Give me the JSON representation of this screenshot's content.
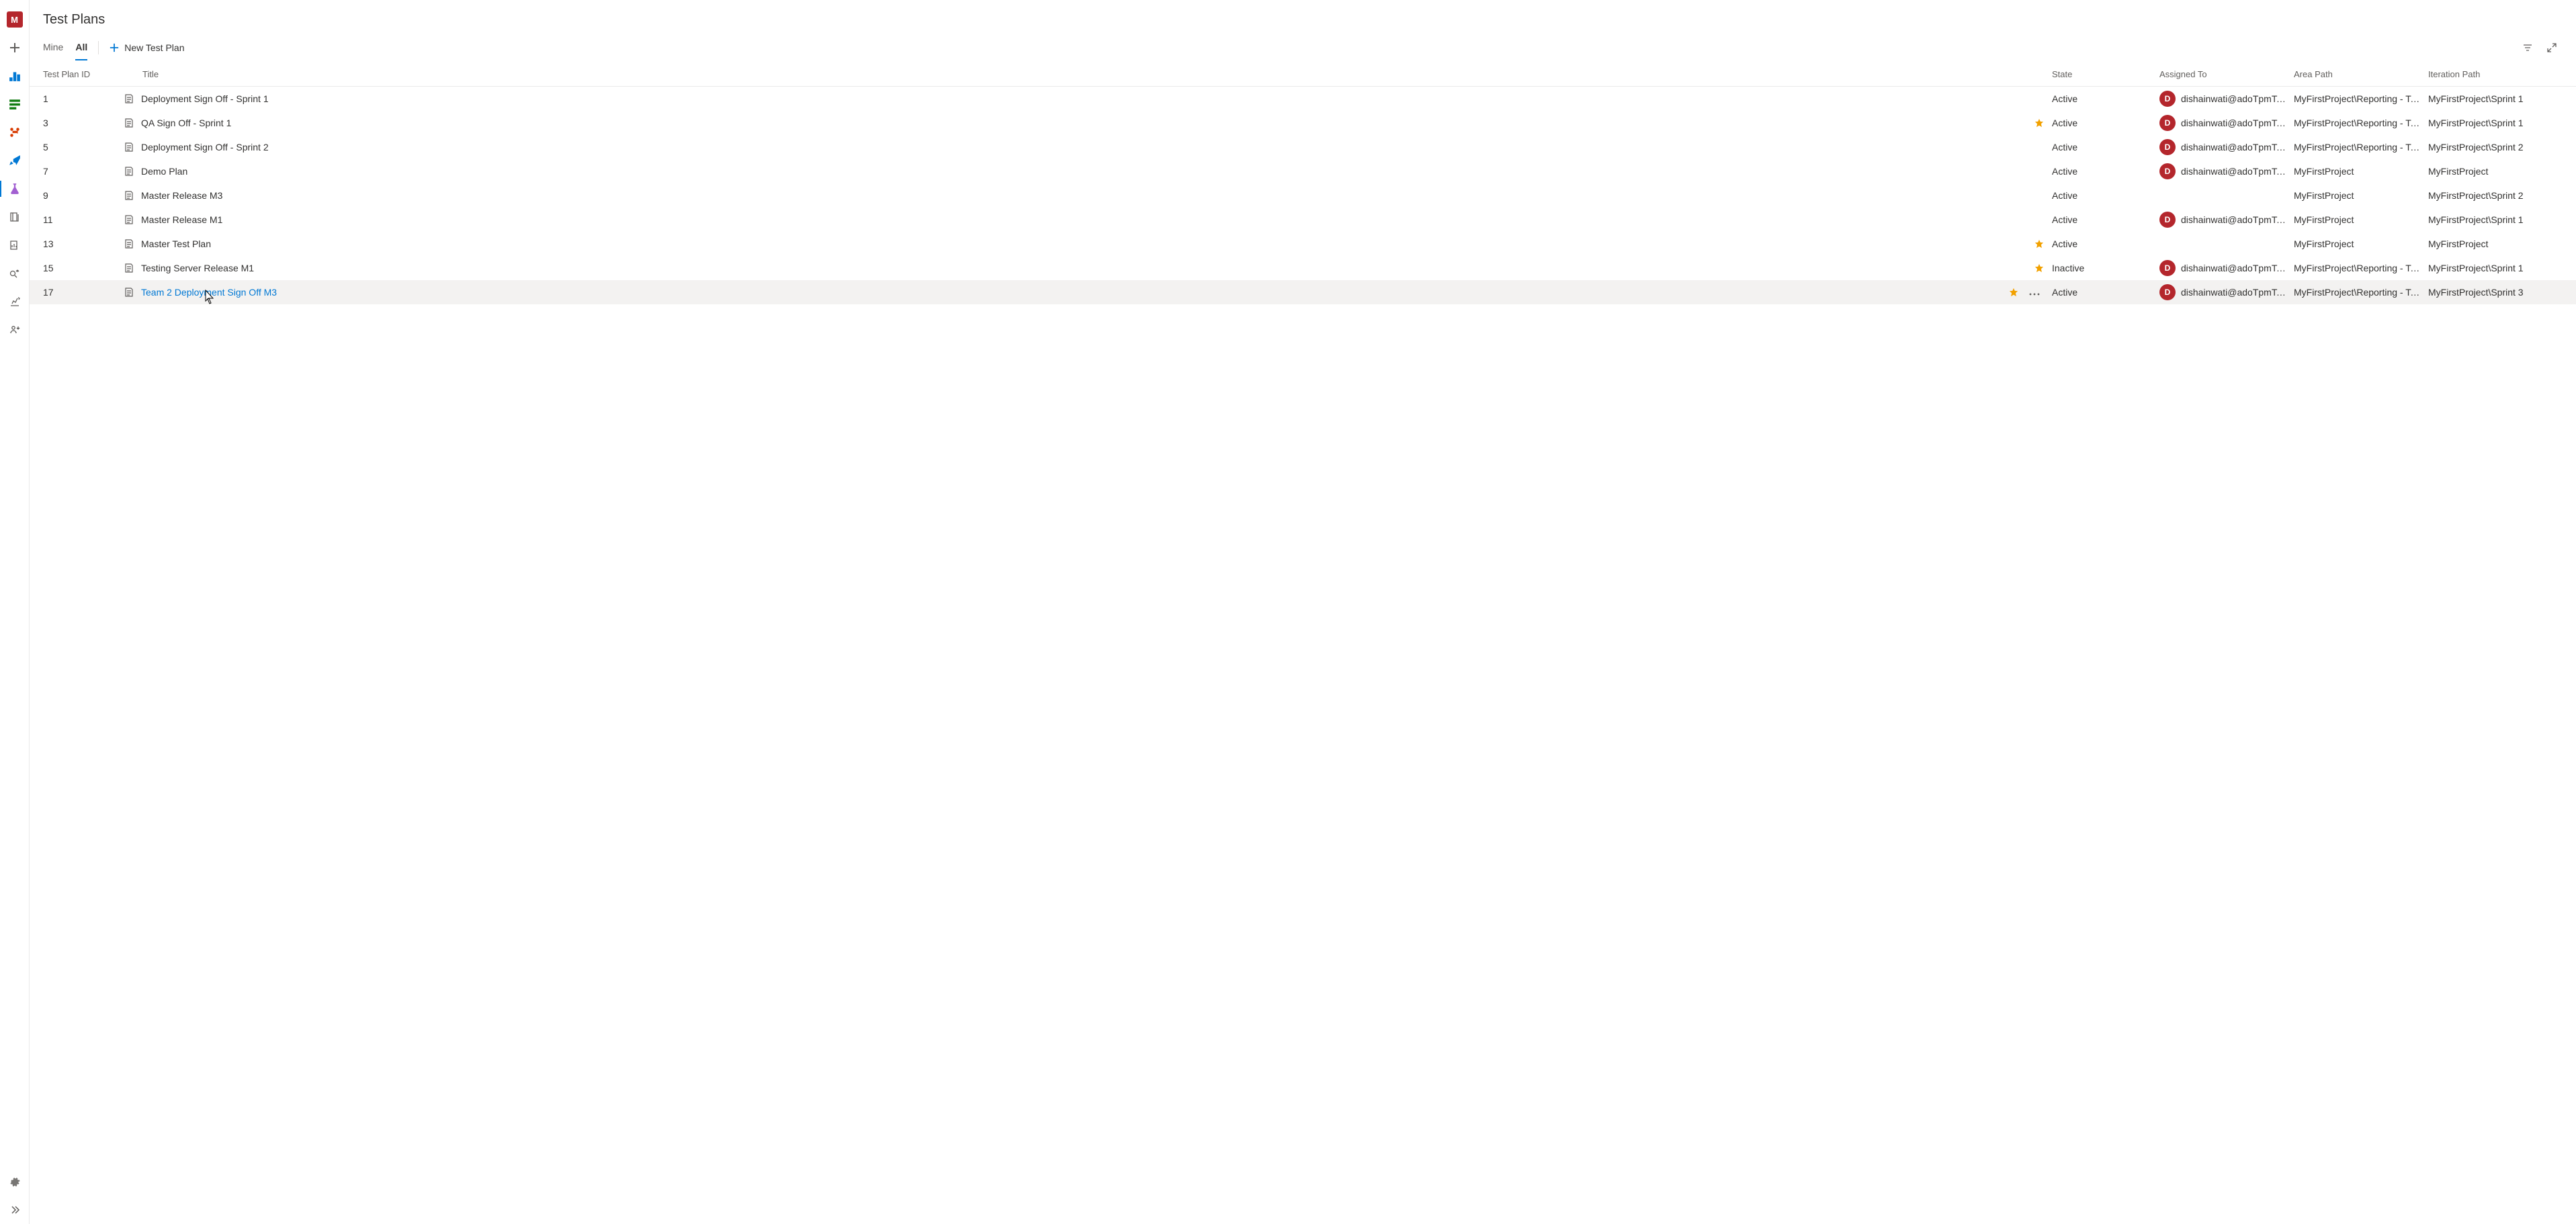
{
  "project_badge": "M",
  "page_title": "Test Plans",
  "tabs": {
    "mine": "Mine",
    "all": "All",
    "active": "all"
  },
  "toolbar": {
    "new_label": "New Test Plan"
  },
  "columns": {
    "id": "Test Plan ID",
    "title": "Title",
    "state": "State",
    "assigned": "Assigned To",
    "area": "Area Path",
    "iteration": "Iteration Path"
  },
  "assignee": {
    "initial": "D",
    "name": "dishainwati@adoTpmTenan"
  },
  "rows": [
    {
      "id": "1",
      "title": "Deployment Sign Off - Sprint 1",
      "star": false,
      "state": "Active",
      "assigned": true,
      "area": "MyFirstProject\\Reporting - Team",
      "iteration": "MyFirstProject\\Sprint 1",
      "hovered": false,
      "link": false
    },
    {
      "id": "3",
      "title": "QA Sign Off - Sprint 1",
      "star": true,
      "state": "Active",
      "assigned": true,
      "area": "MyFirstProject\\Reporting - Team",
      "iteration": "MyFirstProject\\Sprint 1",
      "hovered": false,
      "link": false
    },
    {
      "id": "5",
      "title": "Deployment Sign Off - Sprint 2",
      "star": false,
      "state": "Active",
      "assigned": true,
      "area": "MyFirstProject\\Reporting - Team",
      "iteration": "MyFirstProject\\Sprint 2",
      "hovered": false,
      "link": false
    },
    {
      "id": "7",
      "title": "Demo Plan",
      "star": false,
      "state": "Active",
      "assigned": true,
      "area": "MyFirstProject",
      "iteration": "MyFirstProject",
      "hovered": false,
      "link": false
    },
    {
      "id": "9",
      "title": "Master Release M3",
      "star": false,
      "state": "Active",
      "assigned": false,
      "area": "MyFirstProject",
      "iteration": "MyFirstProject\\Sprint 2",
      "hovered": false,
      "link": false
    },
    {
      "id": "11",
      "title": "Master Release M1",
      "star": false,
      "state": "Active",
      "assigned": true,
      "area": "MyFirstProject",
      "iteration": "MyFirstProject\\Sprint 1",
      "hovered": false,
      "link": false
    },
    {
      "id": "13",
      "title": "Master Test Plan",
      "star": true,
      "state": "Active",
      "assigned": false,
      "area": "MyFirstProject",
      "iteration": "MyFirstProject",
      "hovered": false,
      "link": false
    },
    {
      "id": "15",
      "title": "Testing Server Release M1",
      "star": true,
      "state": "Inactive",
      "assigned": true,
      "area": "MyFirstProject\\Reporting - Team",
      "iteration": "MyFirstProject\\Sprint 1",
      "hovered": false,
      "link": false
    },
    {
      "id": "17",
      "title": "Team 2 Deployment Sign Off M3",
      "star": true,
      "state": "Active",
      "assigned": true,
      "area": "MyFirstProject\\Reporting - Team",
      "iteration": "MyFirstProject\\Sprint 3",
      "hovered": true,
      "link": true
    }
  ]
}
